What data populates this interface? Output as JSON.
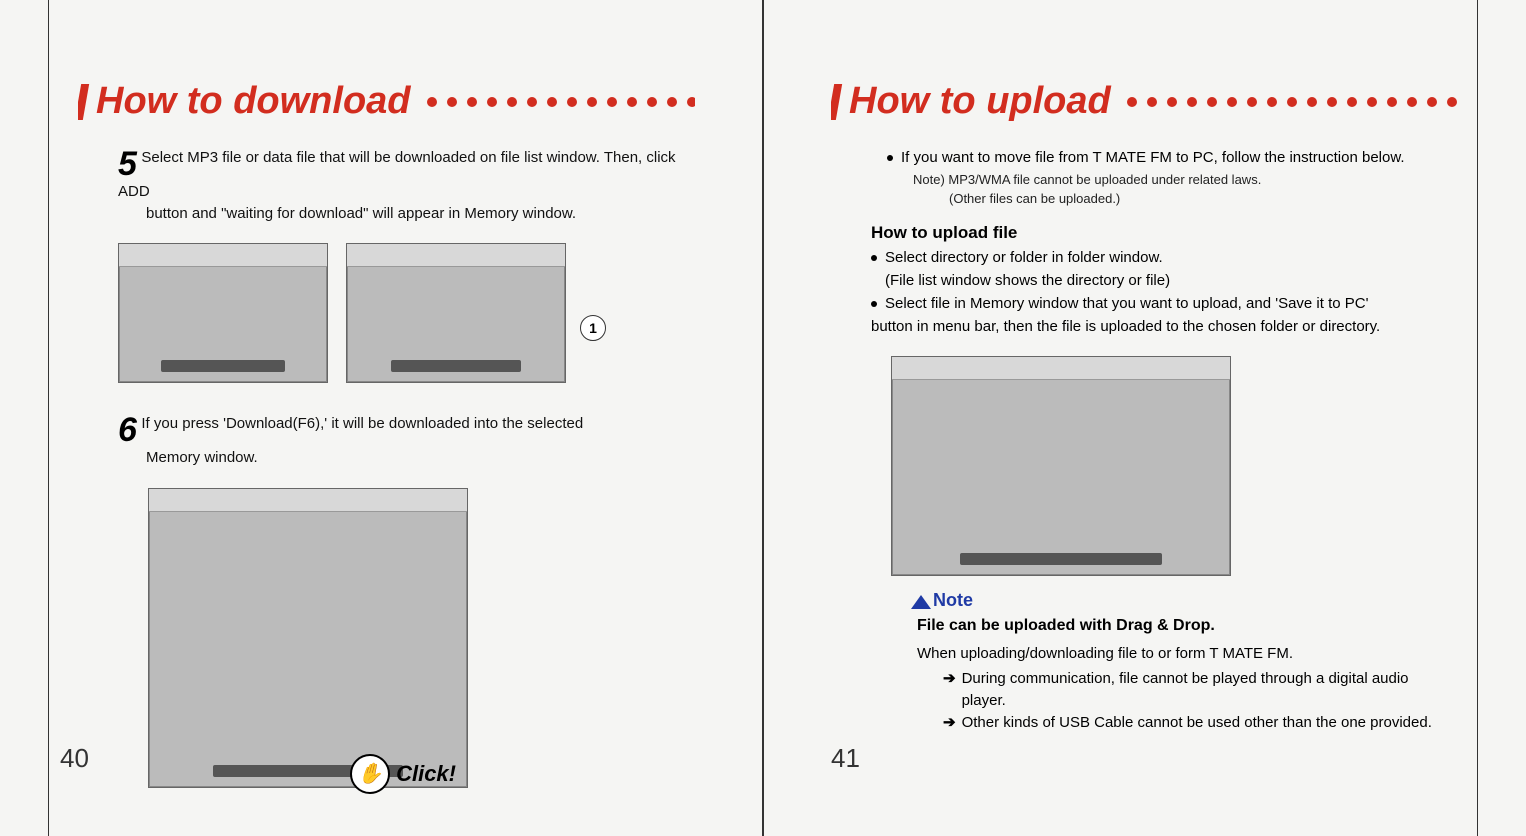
{
  "left": {
    "title": "How to download",
    "step5": {
      "num": "5",
      "text1": "Select MP3 file or data file that will be downloaded on file list window. Then, click ADD",
      "text2": "button and \"waiting for download\" will appear in Memory window."
    },
    "fig1": {
      "callout": "1"
    },
    "step6": {
      "num": "6",
      "text1": "If you press 'Download(F6),' it will be downloaded into the selected",
      "text2": "Memory window."
    },
    "click": "Click!",
    "page_num": "40"
  },
  "right": {
    "title": "How to upload",
    "intro": "If you want to move file from T MATE FM to PC, follow the instruction below.",
    "intro_note1": "Note) MP3/WMA file cannot be uploaded under related laws.",
    "intro_note2": "(Other files can be uploaded.)",
    "subhead": "How to upload file",
    "b1": "Select directory or folder in folder window.",
    "b1_sub": "(File list window shows the directory or file)",
    "b2": "Select file in Memory window that you want to upload, and 'Save it to PC'",
    "b2_cont": "button in menu bar, then the file is uploaded to the chosen folder or directory.",
    "note_label": "Note",
    "note_strong": "File can be uploaded with Drag & Drop.",
    "note_body": "When uploading/downloading file to or form T MATE FM.",
    "arrow1a": "During communication, file cannot be played through a digital audio",
    "arrow1b": "player.",
    "arrow2": "Other kinds of USB Cable cannot be used other than the one provided.",
    "page_num": "41"
  }
}
